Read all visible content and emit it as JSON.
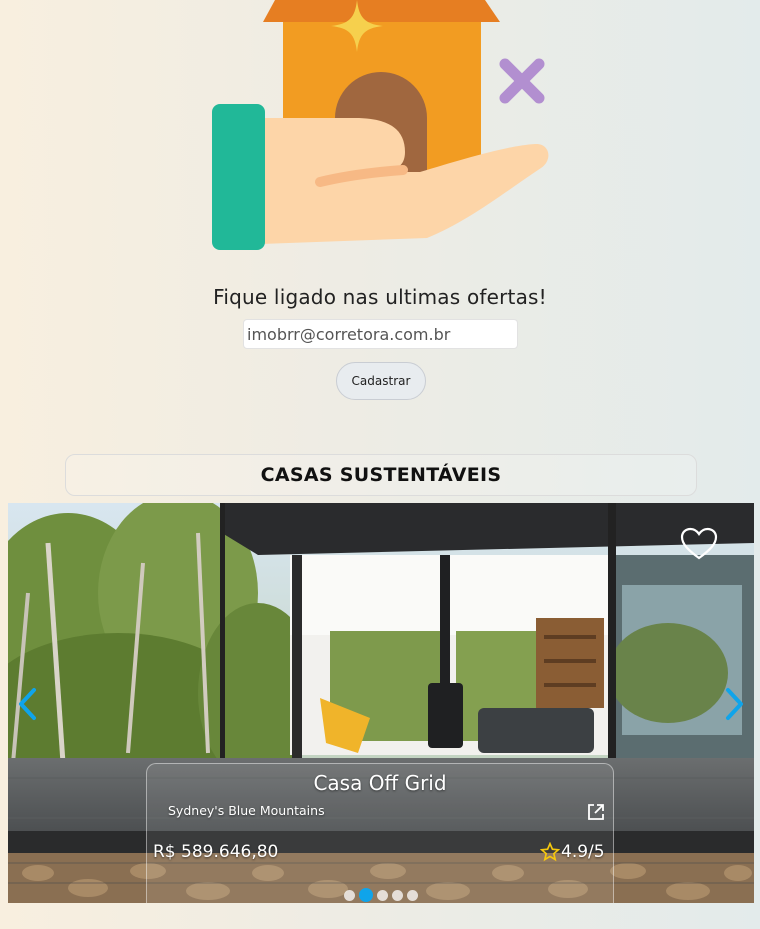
{
  "newsletter": {
    "title": "Fique ligado nas ultimas ofertas!",
    "email_placeholder": "imobrr@corretora.com.br",
    "signup_label": "Cadastrar"
  },
  "section": {
    "title": "CASAS SUSTENTÁVEIS"
  },
  "carousel": {
    "property": {
      "title": "Casa Off Grid",
      "location": "Sydney's Blue Mountains",
      "price": "R$ 589.646,80",
      "rating": "4.9/5"
    },
    "slide_count": 5,
    "active_index": 1
  },
  "icons": {
    "hero": "hand-holding-house-icon",
    "favorite": "heart-outline-icon",
    "prev": "chevron-left-icon",
    "next": "chevron-right-icon",
    "external": "external-link-icon",
    "rating": "star-icon"
  },
  "colors": {
    "accent": "#0fa4ea",
    "house_orange": "#f29c22",
    "roof": "#e67e22",
    "cuff_green": "#21b898",
    "hand_skin": "#fdd5a8",
    "sparkle_purple": "#b28fd0",
    "star_yellow": "#f6c90e"
  }
}
